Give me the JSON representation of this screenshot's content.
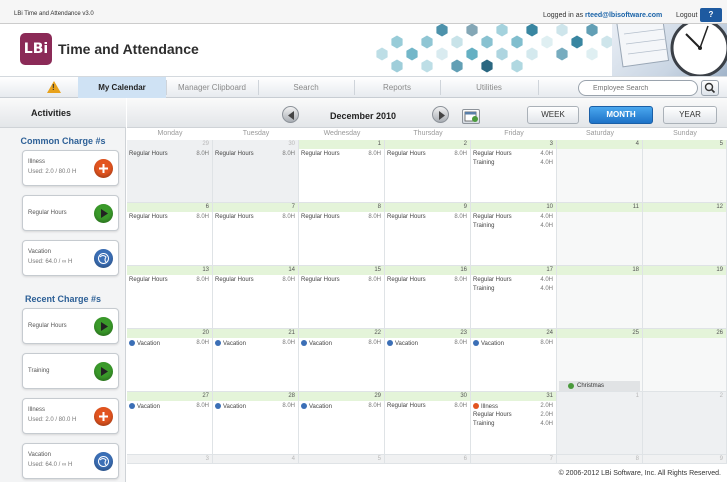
{
  "topbar": {
    "version": "LBi Time and Attendance v3.0",
    "logged_prefix": "Logged in as ",
    "user_email": "rteed@lbisoftware.com",
    "logout_label": "Logout",
    "help_label": "?"
  },
  "header": {
    "logo_text": "LBi",
    "app_title": "Time and Attendance"
  },
  "nav": {
    "warning_mark": "!",
    "tabs": [
      {
        "label": "My Calendar"
      },
      {
        "label": "Manager Clipboard"
      },
      {
        "label": "Search"
      },
      {
        "label": "Reports"
      },
      {
        "label": "Utilities"
      }
    ],
    "search_placeholder": "Employee Search"
  },
  "sidebar": {
    "title": "Activities",
    "common_title": "Common Charge #s",
    "recent_title": "Recent Charge #s",
    "common": [
      {
        "name": "Illness",
        "used": "Used: 2.0 / 80.0 H",
        "icon": "plus-icon"
      },
      {
        "name": "Regular Hours",
        "used": "",
        "icon": "play-icon"
      },
      {
        "name": "Vacation",
        "used": "Used: 64.0 / ∞ H",
        "icon": "globe-icon"
      }
    ],
    "recent": [
      {
        "name": "Regular Hours",
        "used": "",
        "icon": "play-icon"
      },
      {
        "name": "Training",
        "used": "",
        "icon": "play-icon"
      },
      {
        "name": "Illness",
        "used": "Used: 2.0 / 80.0 H",
        "icon": "plus-icon"
      },
      {
        "name": "Vacation",
        "used": "Used: 64.0 / ∞ H",
        "icon": "globe-icon"
      }
    ]
  },
  "calendar": {
    "month_title": "December 2010",
    "views": [
      "WEEK",
      "MONTH",
      "YEAR"
    ],
    "active_view": "MONTH",
    "days": [
      "Monday",
      "Tuesday",
      "Wednesday",
      "Thursday",
      "Friday",
      "Saturday",
      "Sunday"
    ],
    "weeks": [
      [
        {
          "day": "29",
          "dim": true,
          "entries": [
            {
              "name": "Regular Hours",
              "hours": "8.0H"
            }
          ]
        },
        {
          "day": "30",
          "dim": true,
          "entries": [
            {
              "name": "Regular Hours",
              "hours": "8.0H"
            }
          ]
        },
        {
          "day": "1",
          "entries": [
            {
              "name": "Regular Hours",
              "hours": "8.0H"
            }
          ]
        },
        {
          "day": "2",
          "entries": [
            {
              "name": "Regular Hours",
              "hours": "8.0H"
            }
          ]
        },
        {
          "day": "3",
          "entries": [
            {
              "name": "Regular Hours",
              "hours": "4.0H"
            },
            {
              "name": "Training",
              "hours": "4.0H"
            }
          ]
        },
        {
          "day": "4",
          "entries": []
        },
        {
          "day": "5",
          "entries": []
        }
      ],
      [
        {
          "day": "6",
          "entries": [
            {
              "name": "Regular Hours",
              "hours": "8.0H"
            }
          ]
        },
        {
          "day": "7",
          "entries": [
            {
              "name": "Regular Hours",
              "hours": "8.0H"
            }
          ]
        },
        {
          "day": "8",
          "entries": [
            {
              "name": "Regular Hours",
              "hours": "8.0H"
            }
          ]
        },
        {
          "day": "9",
          "entries": [
            {
              "name": "Regular Hours",
              "hours": "8.0H"
            }
          ]
        },
        {
          "day": "10",
          "entries": [
            {
              "name": "Regular Hours",
              "hours": "4.0H"
            },
            {
              "name": "Training",
              "hours": "4.0H"
            }
          ]
        },
        {
          "day": "11",
          "entries": []
        },
        {
          "day": "12",
          "entries": []
        }
      ],
      [
        {
          "day": "13",
          "entries": [
            {
              "name": "Regular Hours",
              "hours": "8.0H"
            }
          ]
        },
        {
          "day": "14",
          "entries": [
            {
              "name": "Regular Hours",
              "hours": "8.0H"
            }
          ]
        },
        {
          "day": "15",
          "entries": [
            {
              "name": "Regular Hours",
              "hours": "8.0H"
            }
          ]
        },
        {
          "day": "16",
          "entries": [
            {
              "name": "Regular Hours",
              "hours": "8.0H"
            }
          ]
        },
        {
          "day": "17",
          "entries": [
            {
              "name": "Regular Hours",
              "hours": "4.0H"
            },
            {
              "name": "Training",
              "hours": "4.0H"
            }
          ]
        },
        {
          "day": "18",
          "entries": []
        },
        {
          "day": "19",
          "entries": []
        }
      ],
      [
        {
          "day": "20",
          "entries": [
            {
              "name": "Vacation",
              "hours": "8.0H",
              "dot": "vacation"
            }
          ]
        },
        {
          "day": "21",
          "entries": [
            {
              "name": "Vacation",
              "hours": "8.0H",
              "dot": "vacation"
            }
          ]
        },
        {
          "day": "22",
          "entries": [
            {
              "name": "Vacation",
              "hours": "8.0H",
              "dot": "vacation"
            }
          ]
        },
        {
          "day": "23",
          "entries": [
            {
              "name": "Vacation",
              "hours": "8.0H",
              "dot": "vacation"
            }
          ]
        },
        {
          "day": "24",
          "entries": [
            {
              "name": "Vacation",
              "hours": "8.0H",
              "dot": "vacation"
            }
          ]
        },
        {
          "day": "25",
          "entries": [],
          "holiday": "Christmas"
        },
        {
          "day": "26",
          "entries": []
        }
      ],
      [
        {
          "day": "27",
          "entries": [
            {
              "name": "Vacation",
              "hours": "8.0H",
              "dot": "vacation"
            }
          ]
        },
        {
          "day": "28",
          "entries": [
            {
              "name": "Vacation",
              "hours": "8.0H",
              "dot": "vacation"
            }
          ]
        },
        {
          "day": "29",
          "entries": [
            {
              "name": "Vacation",
              "hours": "8.0H",
              "dot": "vacation"
            }
          ]
        },
        {
          "day": "30",
          "entries": [
            {
              "name": "Regular Hours",
              "hours": "8.0H"
            }
          ]
        },
        {
          "day": "31",
          "entries": [
            {
              "name": "Illness",
              "hours": "2.0H",
              "dot": "illness"
            },
            {
              "name": "Regular Hours",
              "hours": "2.0H"
            },
            {
              "name": "Training",
              "hours": "4.0H"
            }
          ]
        },
        {
          "day": "1",
          "dim": true,
          "entries": []
        },
        {
          "day": "2",
          "dim": true,
          "entries": []
        }
      ],
      [
        {
          "day": "3",
          "dim": true,
          "blank": true,
          "entries": []
        },
        {
          "day": "4",
          "dim": true,
          "blank": true,
          "entries": []
        },
        {
          "day": "5",
          "dim": true,
          "blank": true,
          "entries": []
        },
        {
          "day": "6",
          "dim": true,
          "blank": true,
          "entries": []
        },
        {
          "day": "7",
          "dim": true,
          "blank": true,
          "entries": []
        },
        {
          "day": "8",
          "dim": true,
          "blank": true,
          "entries": []
        },
        {
          "day": "9",
          "dim": true,
          "blank": true,
          "entries": []
        }
      ]
    ]
  },
  "colors": {
    "brand": "#8b2a57",
    "accent": "#1d72c7",
    "illness": "#e2541f",
    "regular": "#3a9a2a",
    "training": "#2a7cc8",
    "vacation": "#3b6fb6",
    "holiday": "#4a9a3c"
  },
  "footer": {
    "copyright": "© 2006-2012 LBi Software, Inc. All Rights Reserved."
  }
}
